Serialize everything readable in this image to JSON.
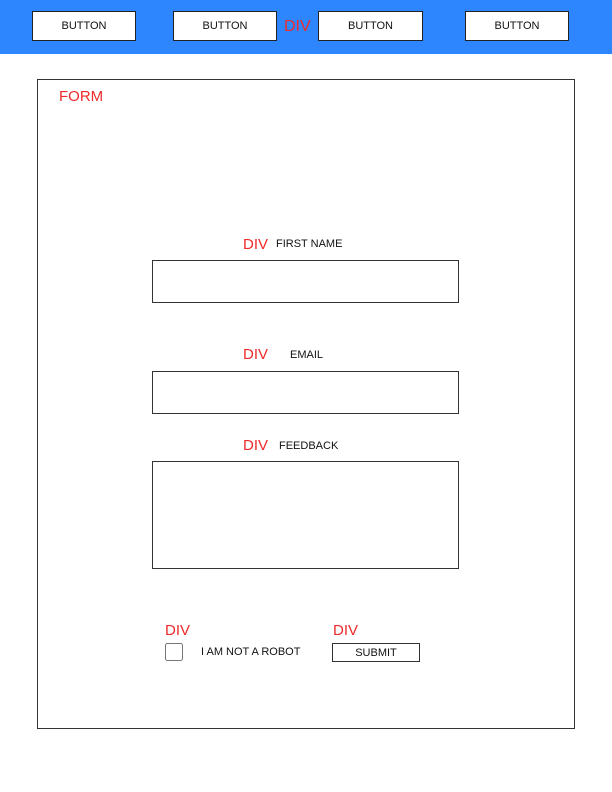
{
  "navbar": {
    "container_label": "DIV",
    "buttons": [
      "BUTTON",
      "BUTTON",
      "BUTTON",
      "BUTTON"
    ]
  },
  "form": {
    "label": "FORM",
    "first_name": {
      "div_label": "DIV",
      "label": "FIRST NAME",
      "value": ""
    },
    "email": {
      "div_label": "DIV",
      "label": "EMAIL",
      "value": ""
    },
    "feedback": {
      "div_label": "DIV",
      "label": "FEEDBACK",
      "value": ""
    },
    "robot": {
      "div_label": "DIV",
      "label": "I AM NOT A ROBOT"
    },
    "submit": {
      "div_label": "DIV",
      "label": "SUBMIT"
    }
  },
  "colors": {
    "navbar_bg": "#2e86ff",
    "annotation_red": "#ee2a2a"
  }
}
